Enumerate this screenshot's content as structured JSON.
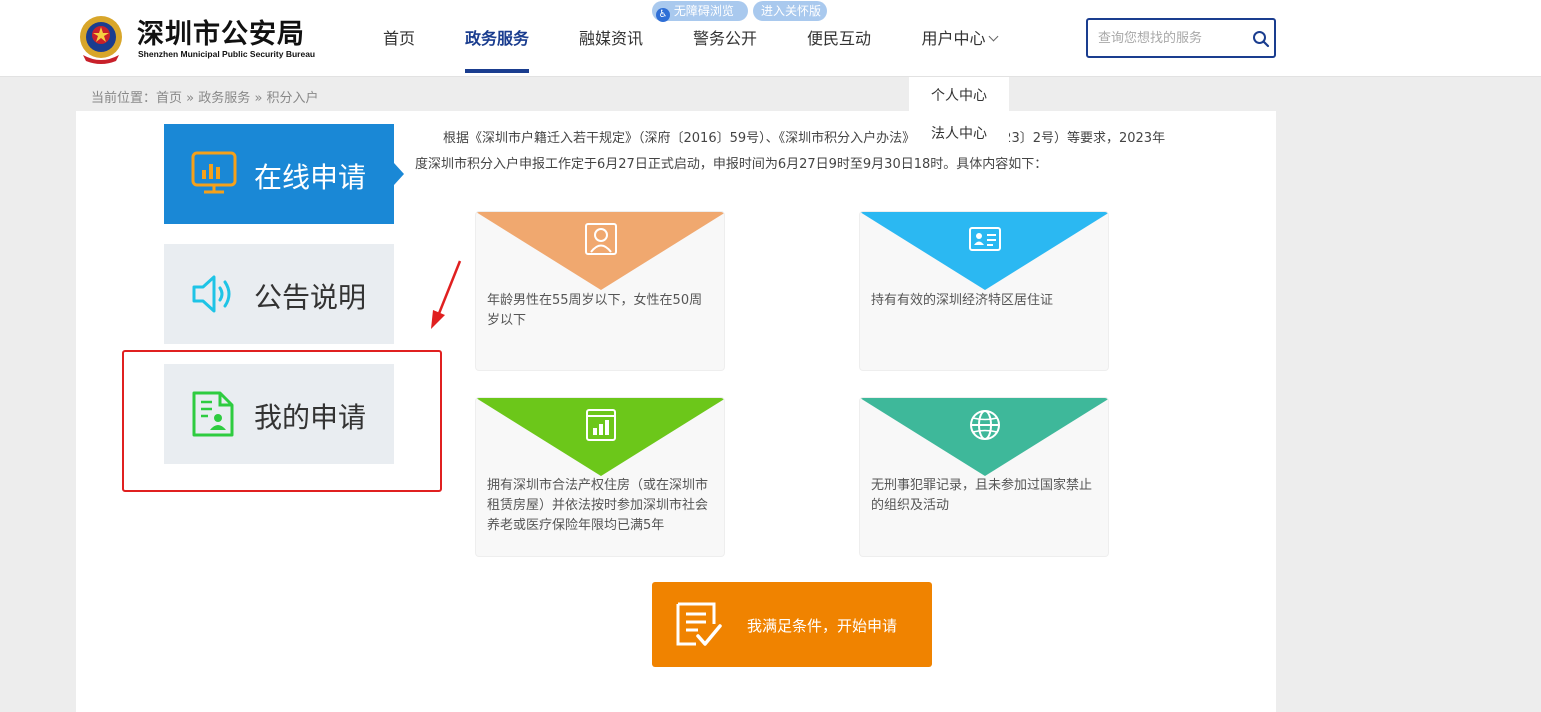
{
  "header": {
    "logo_title": "深圳市公安局",
    "logo_subtitle": "Shenzhen Municipal Public Security Bureau",
    "accessibility_pill": "无障碍浏览",
    "elder_mode_pill": "进入关怀版",
    "nav": [
      {
        "label": "首页"
      },
      {
        "label": "政务服务"
      },
      {
        "label": "融媒资讯"
      },
      {
        "label": "警务公开"
      },
      {
        "label": "便民互动"
      },
      {
        "label": "用户中心"
      }
    ],
    "search_placeholder": "查询您想找的服务",
    "accent_color": "#1a3d8f"
  },
  "user_menu": {
    "items": [
      {
        "label": "个人中心"
      },
      {
        "label": "法人中心"
      }
    ]
  },
  "breadcrumb": {
    "prefix": "当前位置：",
    "items": [
      "首页",
      "政务服务",
      "积分入户"
    ],
    "separator": "»"
  },
  "sidebar": {
    "items": [
      {
        "label": "在线申请",
        "icon": "monitor-chart-icon",
        "active": true
      },
      {
        "label": "公告说明",
        "icon": "speaker-icon",
        "active": false
      },
      {
        "label": "我的申请",
        "icon": "document-user-icon",
        "active": false
      }
    ]
  },
  "intro_text": "根据《深圳市户籍迁入若干规定》（深府〔2016〕59号）、《深圳市积分入户办法》（深发改规〔2023〕2号）等要求，2023年度深圳市积分入户申报工作定于6月27日正式启动，申报时间为6月27日9时至9月30日18时。具体内容如下：",
  "conditions": [
    {
      "text": "年龄男性在55周岁以下，女性在50周岁以下",
      "icon": "person-icon",
      "color": "#f0a86f"
    },
    {
      "text": "持有有效的深圳经济特区居住证",
      "icon": "id-card-icon",
      "color": "#2bb8f2"
    },
    {
      "text": "拥有深圳市合法产权住房（或在深圳市租赁房屋）并依法按时参加深圳市社会养老或医疗保险年限均已满5年",
      "icon": "chart-doc-icon",
      "color": "#6cc71a"
    },
    {
      "text": "无刑事犯罪记录，且未参加过国家禁止的组织及活动",
      "icon": "globe-icon",
      "color": "#3eb89a"
    }
  ],
  "apply_button": {
    "label": "我满足条件，开始申请",
    "color": "#f08300"
  }
}
